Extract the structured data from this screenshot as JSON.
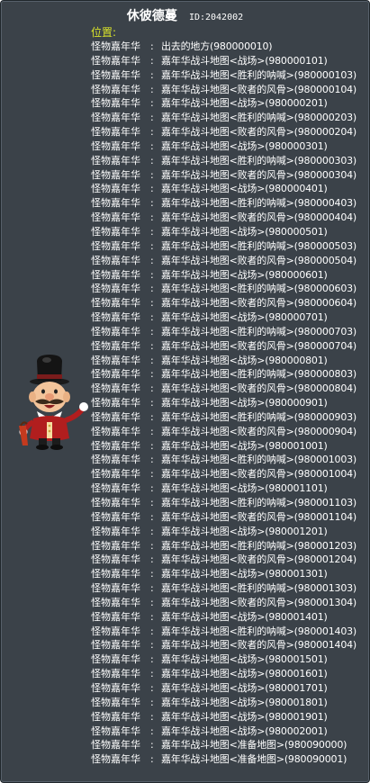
{
  "npc": {
    "name": "休彼德蔓",
    "id_text": "ID:2042002"
  },
  "section_label": "位置:",
  "rows": [
    {
      "who": "怪物嘉年华",
      "sep": ":",
      "dest": "出去的地方(980000010)"
    },
    {
      "who": "怪物嘉年华",
      "sep": ":",
      "dest": "嘉年华战斗地图<战场>(980000101)"
    },
    {
      "who": "怪物嘉年华",
      "sep": ":",
      "dest": "嘉年华战斗地图<胜利的呐喊>(980000103)"
    },
    {
      "who": "怪物嘉年华",
      "sep": ":",
      "dest": "嘉年华战斗地图<败者的风骨>(980000104)"
    },
    {
      "who": "怪物嘉年华",
      "sep": ":",
      "dest": "嘉年华战斗地图<战场>(980000201)"
    },
    {
      "who": "怪物嘉年华",
      "sep": ":",
      "dest": "嘉年华战斗地图<胜利的呐喊>(980000203)"
    },
    {
      "who": "怪物嘉年华",
      "sep": ":",
      "dest": "嘉年华战斗地图<败者的风骨>(980000204)"
    },
    {
      "who": "怪物嘉年华",
      "sep": ":",
      "dest": "嘉年华战斗地图<战场>(980000301)"
    },
    {
      "who": "怪物嘉年华",
      "sep": ":",
      "dest": "嘉年华战斗地图<胜利的呐喊>(980000303)"
    },
    {
      "who": "怪物嘉年华",
      "sep": ":",
      "dest": "嘉年华战斗地图<败者的风骨>(980000304)"
    },
    {
      "who": "怪物嘉年华",
      "sep": ":",
      "dest": "嘉年华战斗地图<战场>(980000401)"
    },
    {
      "who": "怪物嘉年华",
      "sep": ":",
      "dest": "嘉年华战斗地图<胜利的呐喊>(980000403)"
    },
    {
      "who": "怪物嘉年华",
      "sep": ":",
      "dest": "嘉年华战斗地图<败者的风骨>(980000404)"
    },
    {
      "who": "怪物嘉年华",
      "sep": ":",
      "dest": "嘉年华战斗地图<战场>(980000501)"
    },
    {
      "who": "怪物嘉年华",
      "sep": ":",
      "dest": "嘉年华战斗地图<胜利的呐喊>(980000503)"
    },
    {
      "who": "怪物嘉年华",
      "sep": ":",
      "dest": "嘉年华战斗地图<败者的风骨>(980000504)"
    },
    {
      "who": "怪物嘉年华",
      "sep": ":",
      "dest": "嘉年华战斗地图<战场>(980000601)"
    },
    {
      "who": "怪物嘉年华",
      "sep": ":",
      "dest": "嘉年华战斗地图<胜利的呐喊>(980000603)"
    },
    {
      "who": "怪物嘉年华",
      "sep": ":",
      "dest": "嘉年华战斗地图<败者的风骨>(980000604)"
    },
    {
      "who": "怪物嘉年华",
      "sep": ":",
      "dest": "嘉年华战斗地图<战场>(980000701)"
    },
    {
      "who": "怪物嘉年华",
      "sep": ":",
      "dest": "嘉年华战斗地图<胜利的呐喊>(980000703)"
    },
    {
      "who": "怪物嘉年华",
      "sep": ":",
      "dest": "嘉年华战斗地图<败者的风骨>(980000704)"
    },
    {
      "who": "怪物嘉年华",
      "sep": ":",
      "dest": "嘉年华战斗地图<战场>(980000801)"
    },
    {
      "who": "怪物嘉年华",
      "sep": ":",
      "dest": "嘉年华战斗地图<胜利的呐喊>(980000803)"
    },
    {
      "who": "怪物嘉年华",
      "sep": ":",
      "dest": "嘉年华战斗地图<败者的风骨>(980000804)"
    },
    {
      "who": "怪物嘉年华",
      "sep": ":",
      "dest": "嘉年华战斗地图<战场>(980000901)"
    },
    {
      "who": "怪物嘉年华",
      "sep": ":",
      "dest": "嘉年华战斗地图<胜利的呐喊>(980000903)"
    },
    {
      "who": "怪物嘉年华",
      "sep": ":",
      "dest": "嘉年华战斗地图<败者的风骨>(980000904)"
    },
    {
      "who": "怪物嘉年华",
      "sep": ":",
      "dest": "嘉年华战斗地图<战场>(980001001)"
    },
    {
      "who": "怪物嘉年华",
      "sep": ":",
      "dest": "嘉年华战斗地图<胜利的呐喊>(980001003)"
    },
    {
      "who": "怪物嘉年华",
      "sep": ":",
      "dest": "嘉年华战斗地图<败者的风骨>(980001004)"
    },
    {
      "who": "怪物嘉年华",
      "sep": ":",
      "dest": "嘉年华战斗地图<战场>(980001101)"
    },
    {
      "who": "怪物嘉年华",
      "sep": ":",
      "dest": "嘉年华战斗地图<胜利的呐喊>(980001103)"
    },
    {
      "who": "怪物嘉年华",
      "sep": ":",
      "dest": "嘉年华战斗地图<败者的风骨>(980001104)"
    },
    {
      "who": "怪物嘉年华",
      "sep": ":",
      "dest": "嘉年华战斗地图<战场>(980001201)"
    },
    {
      "who": "怪物嘉年华",
      "sep": ":",
      "dest": "嘉年华战斗地图<胜利的呐喊>(980001203)"
    },
    {
      "who": "怪物嘉年华",
      "sep": ":",
      "dest": "嘉年华战斗地图<败者的风骨>(980001204)"
    },
    {
      "who": "怪物嘉年华",
      "sep": ":",
      "dest": "嘉年华战斗地图<战场>(980001301)"
    },
    {
      "who": "怪物嘉年华",
      "sep": ":",
      "dest": "嘉年华战斗地图<胜利的呐喊>(980001303)"
    },
    {
      "who": "怪物嘉年华",
      "sep": ":",
      "dest": "嘉年华战斗地图<败者的风骨>(980001304)"
    },
    {
      "who": "怪物嘉年华",
      "sep": ":",
      "dest": "嘉年华战斗地图<战场>(980001401)"
    },
    {
      "who": "怪物嘉年华",
      "sep": ":",
      "dest": "嘉年华战斗地图<胜利的呐喊>(980001403)"
    },
    {
      "who": "怪物嘉年华",
      "sep": ":",
      "dest": "嘉年华战斗地图<败者的风骨>(980001404)"
    },
    {
      "who": "怪物嘉年华",
      "sep": ":",
      "dest": "嘉年华战斗地图<战场>(980001501)"
    },
    {
      "who": "怪物嘉年华",
      "sep": ":",
      "dest": "嘉年华战斗地图<战场>(980001601)"
    },
    {
      "who": "怪物嘉年华",
      "sep": ":",
      "dest": "嘉年华战斗地图<战场>(980001701)"
    },
    {
      "who": "怪物嘉年华",
      "sep": ":",
      "dest": "嘉年华战斗地图<战场>(980001801)"
    },
    {
      "who": "怪物嘉年华",
      "sep": ":",
      "dest": "嘉年华战斗地图<战场>(980001901)"
    },
    {
      "who": "怪物嘉年华",
      "sep": ":",
      "dest": "嘉年华战斗地图<战场>(980002001)"
    },
    {
      "who": "怪物嘉年华",
      "sep": ":",
      "dest": "嘉年华战斗地图<准备地图>(980090000)"
    },
    {
      "who": "怪物嘉年华",
      "sep": ":",
      "dest": "嘉年华战斗地图<准备地图>(980090001)"
    }
  ],
  "colors": {
    "panel_bg": "#3b4249",
    "label_accent": "#d8e22a",
    "text": "#ffffff"
  }
}
